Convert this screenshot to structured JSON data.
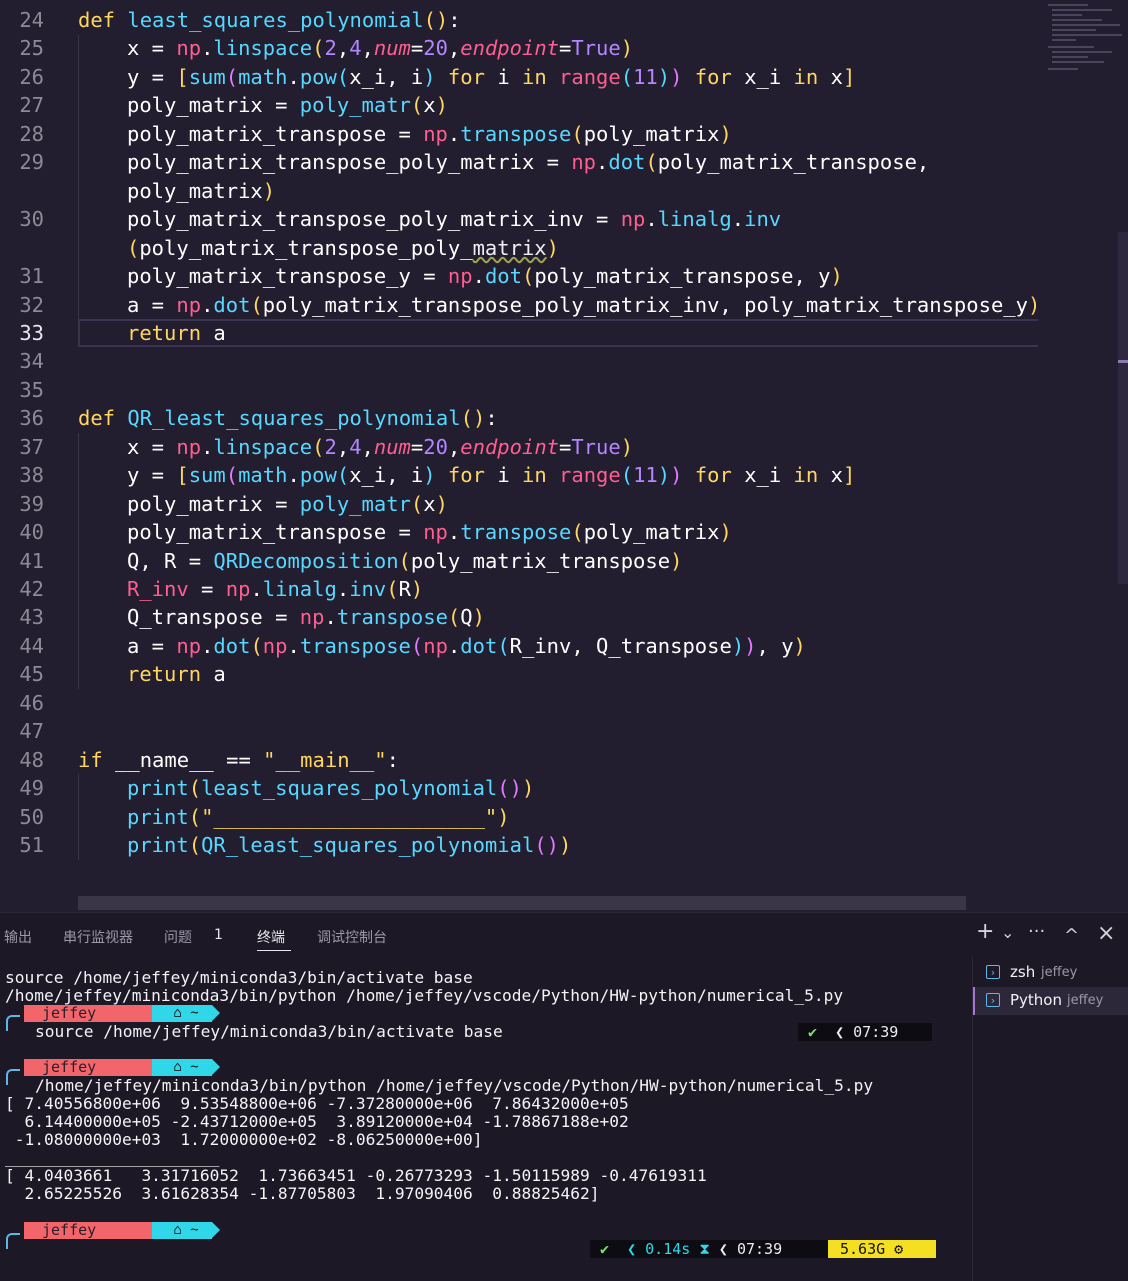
{
  "editor": {
    "lines": [
      {
        "n": "24",
        "indent": 0,
        "tokens": [
          [
            "kw",
            "def "
          ],
          [
            "fn",
            "least_squares_polynomial"
          ],
          [
            "p1",
            "()"
          ],
          [
            "op",
            ":"
          ]
        ]
      },
      {
        "n": "25",
        "indent": 1,
        "tokens": [
          [
            "op",
            "x = "
          ],
          [
            "np",
            "np"
          ],
          [
            "op",
            "."
          ],
          [
            "fn",
            "linspace"
          ],
          [
            "p1",
            "("
          ],
          [
            "num",
            "2"
          ],
          [
            "op",
            ","
          ],
          [
            "num",
            "4"
          ],
          [
            "op",
            ","
          ],
          [
            "param",
            "num"
          ],
          [
            "op",
            "="
          ],
          [
            "num",
            "20"
          ],
          [
            "op",
            ","
          ],
          [
            "param",
            "endpoint"
          ],
          [
            "op",
            "="
          ],
          [
            "bool",
            "True"
          ],
          [
            "p1",
            ")"
          ]
        ]
      },
      {
        "n": "26",
        "indent": 1,
        "tokens": [
          [
            "op",
            "y = "
          ],
          [
            "p1",
            "["
          ],
          [
            "fn",
            "sum"
          ],
          [
            "p2",
            "("
          ],
          [
            "fn",
            "math"
          ],
          [
            "op",
            "."
          ],
          [
            "fn",
            "pow"
          ],
          [
            "p3",
            "("
          ],
          [
            "op",
            "x_i, i"
          ],
          [
            "p3",
            ")"
          ],
          [
            "kw",
            " for "
          ],
          [
            "op",
            "i"
          ],
          [
            "kw",
            " in "
          ],
          [
            "np",
            "range"
          ],
          [
            "p3",
            "("
          ],
          [
            "num",
            "11"
          ],
          [
            "p3",
            ")"
          ],
          [
            "p2",
            ")"
          ],
          [
            "kw",
            " for "
          ],
          [
            "op",
            "x_i"
          ],
          [
            "kw",
            " in "
          ],
          [
            "op",
            "x"
          ],
          [
            "p1",
            "]"
          ]
        ]
      },
      {
        "n": "27",
        "indent": 1,
        "tokens": [
          [
            "op",
            "poly_matrix = "
          ],
          [
            "fn",
            "poly_matr"
          ],
          [
            "p1",
            "("
          ],
          [
            "op",
            "x"
          ],
          [
            "p1",
            ")"
          ]
        ]
      },
      {
        "n": "28",
        "indent": 1,
        "tokens": [
          [
            "op",
            "poly_matrix_transpose = "
          ],
          [
            "np",
            "np"
          ],
          [
            "op",
            "."
          ],
          [
            "fn",
            "transpose"
          ],
          [
            "p1",
            "("
          ],
          [
            "op",
            "poly_matrix"
          ],
          [
            "p1",
            ")"
          ]
        ]
      },
      {
        "n": "29",
        "indent": 1,
        "tokens": [
          [
            "op",
            "poly_matrix_transpose_poly_matrix = "
          ],
          [
            "np",
            "np"
          ],
          [
            "op",
            "."
          ],
          [
            "fn",
            "dot"
          ],
          [
            "p1",
            "("
          ],
          [
            "op",
            "poly_matrix_transpose,"
          ]
        ]
      },
      {
        "n": "",
        "indent": 1,
        "tokens": [
          [
            "op",
            "poly_matrix"
          ],
          [
            "p1",
            ")"
          ]
        ]
      },
      {
        "n": "30",
        "indent": 1,
        "tokens": [
          [
            "op",
            "poly_matrix_transpose_poly_matrix_inv = "
          ],
          [
            "np",
            "np"
          ],
          [
            "op",
            "."
          ],
          [
            "fn",
            "linalg"
          ],
          [
            "op",
            "."
          ],
          [
            "fn",
            "inv"
          ]
        ]
      },
      {
        "n": "",
        "indent": 1,
        "tokens": [
          [
            "p1",
            "("
          ],
          [
            "op",
            "poly_matrix_transpose_poly_"
          ],
          [
            "squig",
            "matrix"
          ],
          [
            "p1",
            ")"
          ]
        ]
      },
      {
        "n": "31",
        "indent": 1,
        "tokens": [
          [
            "op",
            "poly_matrix_transpose_y = "
          ],
          [
            "np",
            "np"
          ],
          [
            "op",
            "."
          ],
          [
            "fn",
            "dot"
          ],
          [
            "p1",
            "("
          ],
          [
            "op",
            "poly_matrix_transpose, y"
          ],
          [
            "p1",
            ")"
          ]
        ]
      },
      {
        "n": "32",
        "indent": 1,
        "tokens": [
          [
            "op",
            "a = "
          ],
          [
            "np",
            "np"
          ],
          [
            "op",
            "."
          ],
          [
            "fn",
            "dot"
          ],
          [
            "p1",
            "("
          ],
          [
            "op",
            "poly_matrix_transpose_poly_matrix_inv, poly_matrix_transpose_y"
          ],
          [
            "p1",
            ")"
          ]
        ]
      },
      {
        "n": "33",
        "indent": 1,
        "tokens": [
          [
            "kw",
            "return"
          ],
          [
            "op",
            " a"
          ]
        ]
      },
      {
        "n": "34",
        "indent": 0,
        "tokens": []
      },
      {
        "n": "35",
        "indent": 0,
        "tokens": []
      },
      {
        "n": "36",
        "indent": 0,
        "tokens": [
          [
            "kw",
            "def "
          ],
          [
            "fn",
            "QR_least_squares_polynomial"
          ],
          [
            "p1",
            "()"
          ],
          [
            "op",
            ":"
          ]
        ]
      },
      {
        "n": "37",
        "indent": 1,
        "tokens": [
          [
            "op",
            "x = "
          ],
          [
            "np",
            "np"
          ],
          [
            "op",
            "."
          ],
          [
            "fn",
            "linspace"
          ],
          [
            "p1",
            "("
          ],
          [
            "num",
            "2"
          ],
          [
            "op",
            ","
          ],
          [
            "num",
            "4"
          ],
          [
            "op",
            ","
          ],
          [
            "param",
            "num"
          ],
          [
            "op",
            "="
          ],
          [
            "num",
            "20"
          ],
          [
            "op",
            ","
          ],
          [
            "param",
            "endpoint"
          ],
          [
            "op",
            "="
          ],
          [
            "bool",
            "True"
          ],
          [
            "p1",
            ")"
          ]
        ]
      },
      {
        "n": "38",
        "indent": 1,
        "tokens": [
          [
            "op",
            "y = "
          ],
          [
            "p1",
            "["
          ],
          [
            "fn",
            "sum"
          ],
          [
            "p2",
            "("
          ],
          [
            "fn",
            "math"
          ],
          [
            "op",
            "."
          ],
          [
            "fn",
            "pow"
          ],
          [
            "p3",
            "("
          ],
          [
            "op",
            "x_i, i"
          ],
          [
            "p3",
            ")"
          ],
          [
            "kw",
            " for "
          ],
          [
            "op",
            "i"
          ],
          [
            "kw",
            " in "
          ],
          [
            "np",
            "range"
          ],
          [
            "p3",
            "("
          ],
          [
            "num",
            "11"
          ],
          [
            "p3",
            ")"
          ],
          [
            "p2",
            ")"
          ],
          [
            "kw",
            " for "
          ],
          [
            "op",
            "x_i"
          ],
          [
            "kw",
            " in "
          ],
          [
            "op",
            "x"
          ],
          [
            "p1",
            "]"
          ]
        ]
      },
      {
        "n": "39",
        "indent": 1,
        "tokens": [
          [
            "op",
            "poly_matrix = "
          ],
          [
            "fn",
            "poly_matr"
          ],
          [
            "p1",
            "("
          ],
          [
            "op",
            "x"
          ],
          [
            "p1",
            ")"
          ]
        ]
      },
      {
        "n": "40",
        "indent": 1,
        "tokens": [
          [
            "op",
            "poly_matrix_transpose = "
          ],
          [
            "np",
            "np"
          ],
          [
            "op",
            "."
          ],
          [
            "fn",
            "transpose"
          ],
          [
            "p1",
            "("
          ],
          [
            "op",
            "poly_matrix"
          ],
          [
            "p1",
            ")"
          ]
        ]
      },
      {
        "n": "41",
        "indent": 1,
        "tokens": [
          [
            "op",
            "Q, R = "
          ],
          [
            "fn",
            "QRDecomposition"
          ],
          [
            "p1",
            "("
          ],
          [
            "op",
            "poly_matrix_transpose"
          ],
          [
            "p1",
            ")"
          ]
        ]
      },
      {
        "n": "42",
        "indent": 1,
        "tokens": [
          [
            "var",
            "R_inv"
          ],
          [
            "op",
            " = "
          ],
          [
            "np",
            "np"
          ],
          [
            "op",
            "."
          ],
          [
            "fn",
            "linalg"
          ],
          [
            "op",
            "."
          ],
          [
            "fn",
            "inv"
          ],
          [
            "p1",
            "("
          ],
          [
            "op",
            "R"
          ],
          [
            "p1",
            ")"
          ]
        ]
      },
      {
        "n": "43",
        "indent": 1,
        "tokens": [
          [
            "op",
            "Q_transpose = "
          ],
          [
            "np",
            "np"
          ],
          [
            "op",
            "."
          ],
          [
            "fn",
            "transpose"
          ],
          [
            "p1",
            "("
          ],
          [
            "op",
            "Q"
          ],
          [
            "p1",
            ")"
          ]
        ]
      },
      {
        "n": "44",
        "indent": 1,
        "tokens": [
          [
            "op",
            "a = "
          ],
          [
            "np",
            "np"
          ],
          [
            "op",
            "."
          ],
          [
            "fn",
            "dot"
          ],
          [
            "p1",
            "("
          ],
          [
            "np",
            "np"
          ],
          [
            "op",
            "."
          ],
          [
            "fn",
            "transpose"
          ],
          [
            "p2",
            "("
          ],
          [
            "np",
            "np"
          ],
          [
            "op",
            "."
          ],
          [
            "fn",
            "dot"
          ],
          [
            "p3",
            "("
          ],
          [
            "op",
            "R_inv, Q_transpose"
          ],
          [
            "p3",
            ")"
          ],
          [
            "p2",
            ")"
          ],
          [
            "op",
            ", y"
          ],
          [
            "p1",
            ")"
          ]
        ]
      },
      {
        "n": "45",
        "indent": 1,
        "tokens": [
          [
            "kw",
            "return"
          ],
          [
            "op",
            " a"
          ]
        ]
      },
      {
        "n": "46",
        "indent": 0,
        "tokens": []
      },
      {
        "n": "47",
        "indent": 0,
        "tokens": []
      },
      {
        "n": "48",
        "indent": 0,
        "tokens": [
          [
            "kw",
            "if "
          ],
          [
            "op",
            "__name__ == "
          ],
          [
            "str",
            "\"__main__\""
          ],
          [
            "op",
            ":"
          ]
        ]
      },
      {
        "n": "49",
        "indent": 1,
        "tokens": [
          [
            "fn",
            "print"
          ],
          [
            "p1",
            "("
          ],
          [
            "fn",
            "least_squares_polynomial"
          ],
          [
            "p2",
            "()"
          ],
          [
            "p1",
            ")"
          ]
        ]
      },
      {
        "n": "50",
        "indent": 1,
        "tokens": [
          [
            "fn",
            "print"
          ],
          [
            "p1",
            "("
          ],
          [
            "str",
            "\"______________________\""
          ],
          [
            "p1",
            ")"
          ]
        ]
      },
      {
        "n": "51",
        "indent": 1,
        "tokens": [
          [
            "fn",
            "print"
          ],
          [
            "p1",
            "("
          ],
          [
            "fn",
            "QR_least_squares_polynomial"
          ],
          [
            "p2",
            "()"
          ],
          [
            "p1",
            ")"
          ]
        ]
      }
    ],
    "current_line": "33"
  },
  "panel": {
    "tabs": [
      {
        "label": "输出",
        "active": false
      },
      {
        "label": "串行监视器",
        "active": false
      },
      {
        "label": "问题",
        "active": false
      },
      {
        "label": "终端",
        "active": true
      },
      {
        "label": "调试控制台",
        "active": false
      }
    ],
    "problems_count": "1",
    "tools": {
      "add": "+",
      "dropdown": "⌄",
      "more": "···",
      "maximize": "^",
      "close": "×"
    },
    "terminal": {
      "line1": "source /home/jeffey/miniconda3/bin/activate base",
      "line2": "/home/jeffey/miniconda3/bin/python /home/jeffey/vscode/Python/HW-python/numerical_5.py",
      "prompt_user": "jeffey",
      "prompt_home": "~",
      "cmd1": "source /home/jeffey/miniconda3/bin/activate base",
      "status1_time": "07:39",
      "cmd2": "/home/jeffey/miniconda3/bin/python /home/jeffey/vscode/Python/HW-python/numerical_5.py",
      "out1": "[ 7.40556800e+06  9.53548800e+06 -7.37280000e+06  7.86432000e+05",
      "out2": "  6.14400000e+05 -2.43712000e+05  3.89120000e+04 -1.78867188e+02",
      "out3": " -1.08000000e+03  1.72000000e+02 -8.06250000e+00]",
      "out4": "______________________",
      "out5": "[ 4.0403661   3.31716052  1.73663451 -0.26773293 -1.50115989 -0.47619311",
      "out6": "  2.65225526  3.61628354 -1.87705803  1.97090406  0.88825462]",
      "status2_duration": "0.14s",
      "status2_time": "07:39",
      "status2_mem": "5.63G"
    },
    "sessions": [
      {
        "name": "zsh",
        "user": "jeffey",
        "active": false
      },
      {
        "name": "Python",
        "user": "jeffey",
        "active": true
      }
    ]
  }
}
